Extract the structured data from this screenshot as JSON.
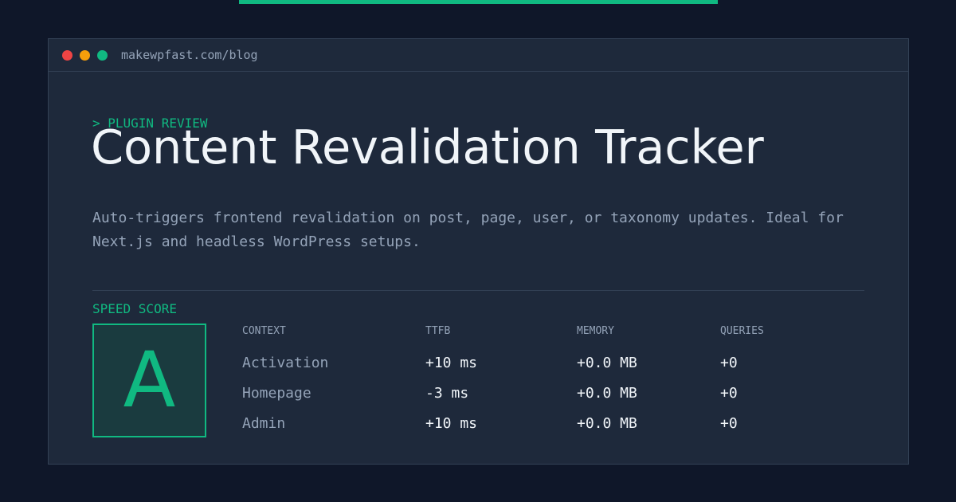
{
  "browser": {
    "url": "makewpfast.com/blog"
  },
  "article": {
    "eyebrow": "> PLUGIN REVIEW",
    "title": "Content Revalidation Tracker",
    "description": "Auto-triggers frontend revalidation on post, page, user, or taxonomy updates. Ideal for Next.js and headless WordPress setups."
  },
  "speed_score": {
    "label": "SPEED SCORE",
    "grade": "A"
  },
  "metrics": {
    "headers": [
      "CONTEXT",
      "TTFB",
      "MEMORY",
      "QUERIES"
    ],
    "rows": [
      {
        "context": "Activation",
        "ttfb": "+10 ms",
        "memory": "+0.0 MB",
        "queries": "+0"
      },
      {
        "context": "Homepage",
        "ttfb": "-3 ms",
        "memory": "+0.0 MB",
        "queries": "+0"
      },
      {
        "context": "Admin",
        "ttfb": "+10 ms",
        "memory": "+0.0 MB",
        "queries": "+0"
      }
    ]
  },
  "colors": {
    "accent": "#10b981",
    "background": "#0f1729",
    "panel": "#1e293b",
    "muted_text": "#94a3b8",
    "bright_text": "#f1f5f9"
  }
}
